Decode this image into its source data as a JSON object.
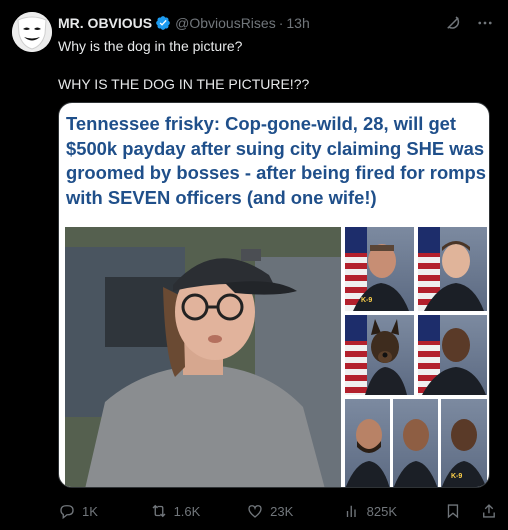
{
  "author": {
    "name": "MR. OBVIOUS",
    "handle": "@ObviousRises",
    "separator": "·",
    "time": "13h"
  },
  "post": {
    "line1": "Why is the dog in the picture?",
    "line2": "WHY IS THE DOG IN THE PICTURE!??"
  },
  "media": {
    "headline": "Tennessee frisky: Cop-gone-wild, 28, will get $500k payday after suing city claiming SHE was groomed by bosses - after being fired for romps with SEVEN officers (and one wife!)",
    "badge_text": "K-9"
  },
  "actions": {
    "replies": "1K",
    "reposts": "1.6K",
    "likes": "23K",
    "views": "825K"
  },
  "colors": {
    "accent": "#1d9bf0",
    "headline": "#1f4f8a",
    "muted": "#71767b"
  },
  "icons": [
    "verified-badge-icon",
    "grok-icon",
    "more-icon",
    "reply-icon",
    "repost-icon",
    "like-icon",
    "views-icon",
    "bookmark-icon",
    "share-icon"
  ]
}
